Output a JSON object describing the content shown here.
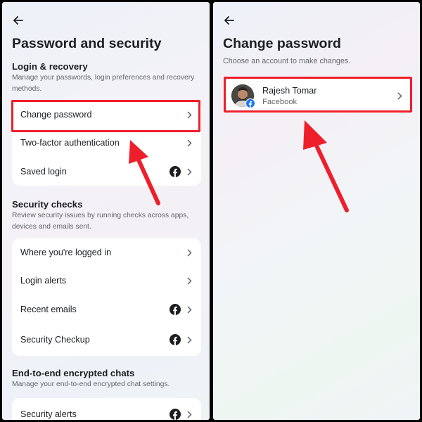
{
  "left": {
    "title": "Password and security",
    "login_recovery": {
      "heading": "Login & recovery",
      "description": "Manage your passwords, login preferences and recovery methods.",
      "items": [
        {
          "label": "Change password",
          "icon": "chevron-right-icon"
        },
        {
          "label": "Two-factor authentication",
          "icon": "chevron-right-icon"
        },
        {
          "label": "Saved login",
          "icon": "facebook-icon"
        }
      ]
    },
    "security_checks": {
      "heading": "Security checks",
      "description": "Review security issues by running checks across apps, devices and emails sent.",
      "items": [
        {
          "label": "Where you're logged in"
        },
        {
          "label": "Login alerts"
        },
        {
          "label": "Recent emails"
        },
        {
          "label": "Security Checkup"
        }
      ]
    },
    "encrypted_chats": {
      "heading": "End-to-end encrypted chats",
      "description": "Manage your end-to-end encrypted chat settings.",
      "items": [
        {
          "label": "Security alerts"
        }
      ]
    }
  },
  "right": {
    "title": "Change password",
    "subtitle": "Choose an account to make changes.",
    "account": {
      "name": "Rajesh Tomar",
      "platform": "Facebook"
    }
  },
  "colors": {
    "highlight": "#ee1f2b",
    "facebook": "#1c1e21",
    "facebook_badge": "#1877f2"
  }
}
